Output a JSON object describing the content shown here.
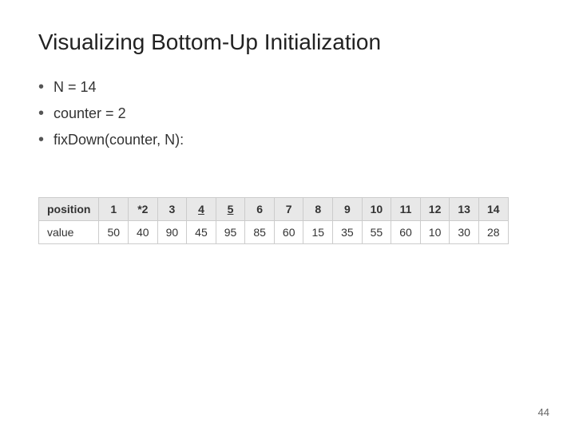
{
  "title": "Visualizing Bottom-Up Initialization",
  "bullets": [
    "N = 14",
    "counter = 2",
    "fixDown(counter, N):"
  ],
  "table": {
    "headers": [
      "position",
      "1",
      "*2",
      "3",
      "4",
      "5",
      "6",
      "7",
      "8",
      "9",
      "10",
      "11",
      "12",
      "13",
      "14"
    ],
    "values": [
      "value",
      "50",
      "40",
      "90",
      "45",
      "95",
      "85",
      "60",
      "15",
      "35",
      "55",
      "60",
      "10",
      "30",
      "28"
    ],
    "underline_cols": [
      3,
      4
    ],
    "bold_cols": [
      2
    ]
  },
  "page_number": "44"
}
